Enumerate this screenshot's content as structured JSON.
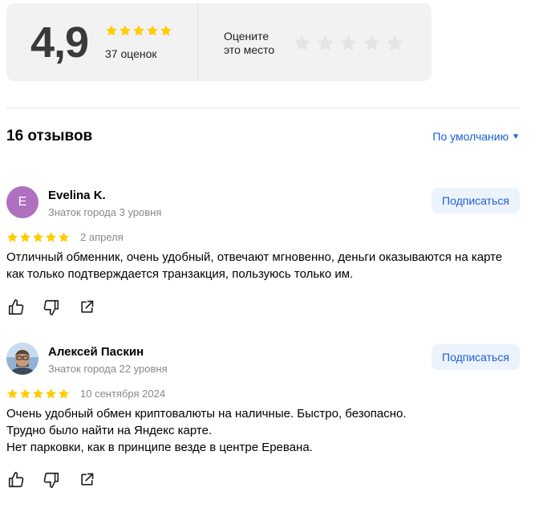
{
  "rating": {
    "score": "4,9",
    "count_label": "37 оценок",
    "stars": 5,
    "rate_prompt_line1": "Оцените",
    "rate_prompt_line2": "это место"
  },
  "reviews_header": {
    "title": "16 отзывов",
    "sort_label": "По умолчанию"
  },
  "reviews": [
    {
      "author": "Evelina K.",
      "avatar_letter": "E",
      "level": "Знаток города 3 уровня",
      "subscribe_label": "Подписаться",
      "stars": 5,
      "date": "2 апреля",
      "text": "Отличный обменник, очень удобный, отвечают мгновенно, деньги оказываются на карте как только подтверждается транзакция, пользуюсь только им."
    },
    {
      "author": "Алексей Паскин",
      "level": "Знаток города 22 уровня",
      "subscribe_label": "Подписаться",
      "stars": 5,
      "date": "10 сентября 2024",
      "text": "Очень удобный обмен криптовалюты на наличные. Быстро, безопасно.\nТрудно было найти на Яндекс карте.\nНет парковки, как в принципе везде в центре Еревана."
    }
  ],
  "colors": {
    "star_filled": "#ffcc00",
    "star_empty": "#e4e4e4",
    "link_blue": "#1a5fd8",
    "avatar_purple": "#b070c0"
  }
}
